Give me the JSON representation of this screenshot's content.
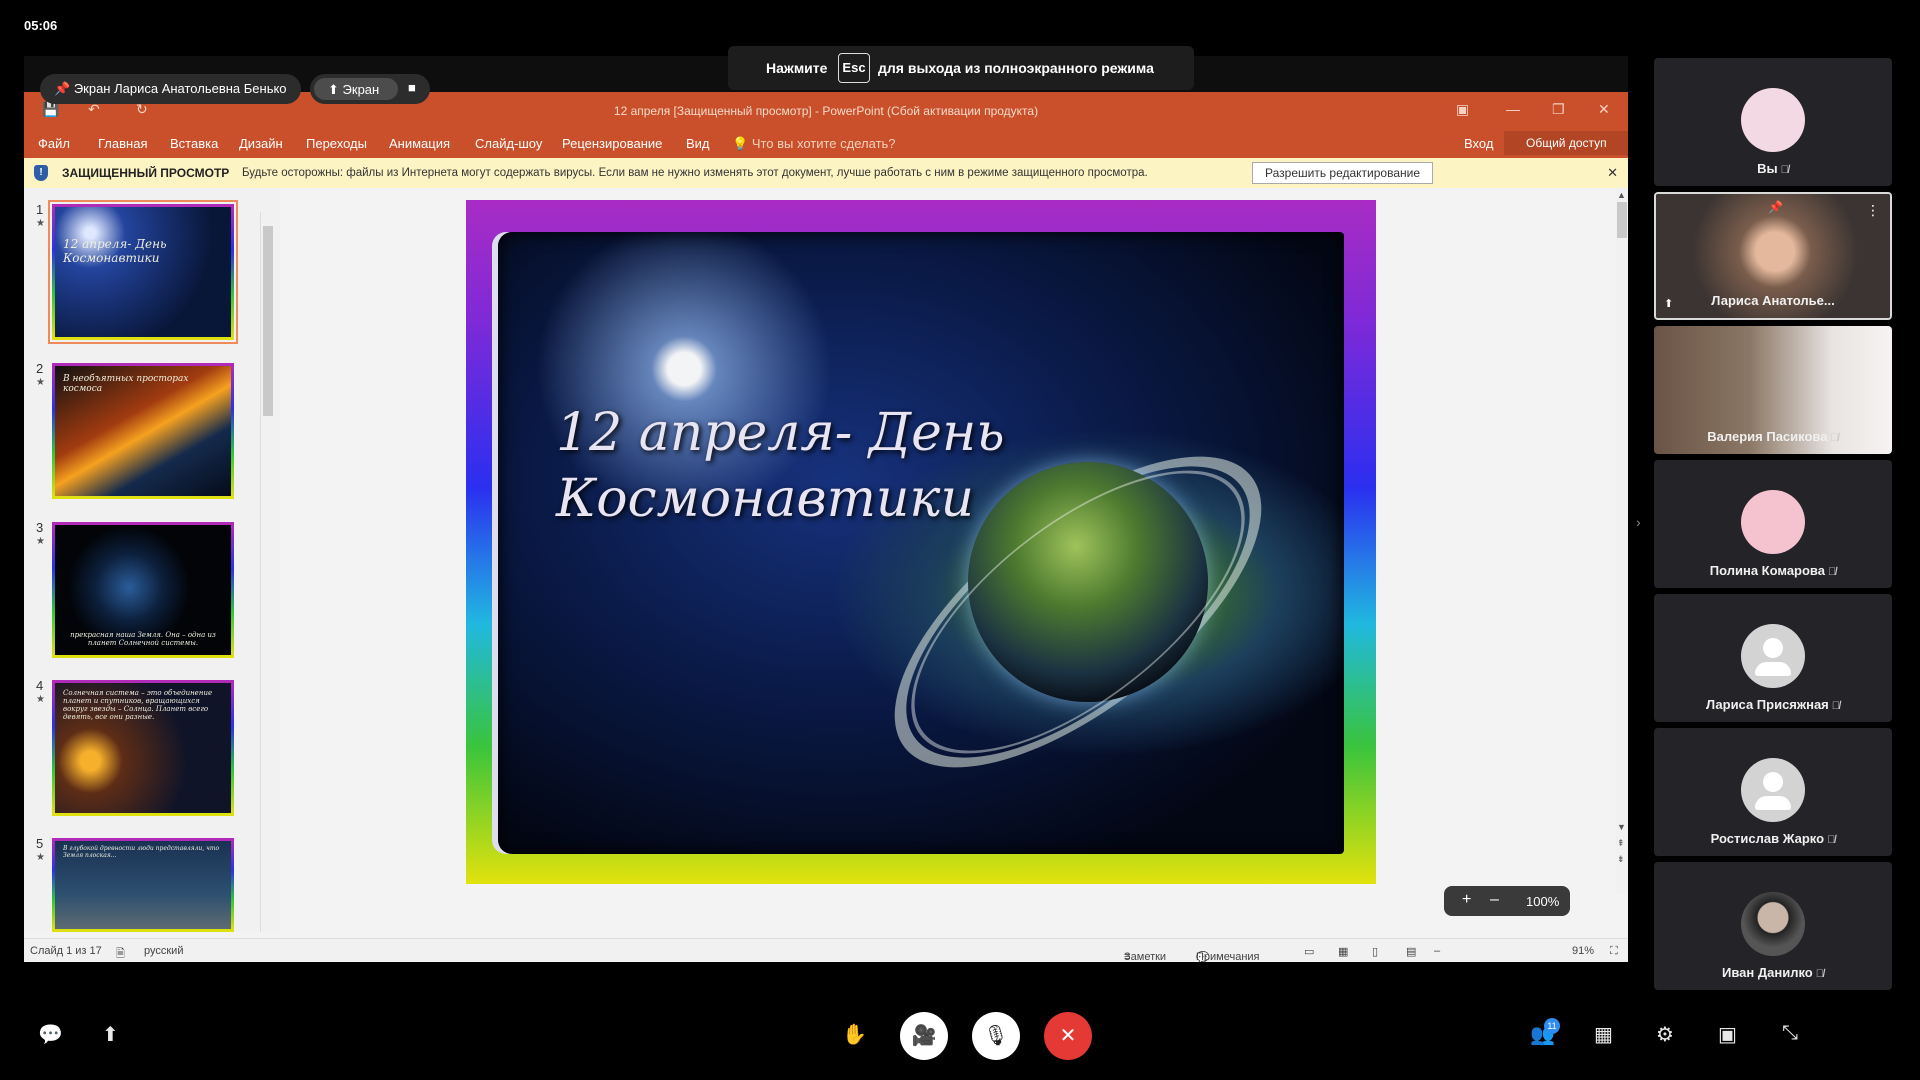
{
  "clock": "05:06",
  "esc_hint": {
    "before": "Нажмите",
    "key": "Esc",
    "after": "для выхода из полноэкранного режима"
  },
  "pin_pill": {
    "label": "Экран Лариса Анатольевна Бенько"
  },
  "screen_pill": {
    "label": "Экран"
  },
  "powerpoint": {
    "window_title": "12 апреля [Защищенный просмотр] - PowerPoint (Сбой активации продукта)",
    "tabs": [
      "Файл",
      "Главная",
      "Вставка",
      "Дизайн",
      "Переходы",
      "Анимация",
      "Слайд-шоу",
      "Рецензирование",
      "Вид"
    ],
    "tell_me": "Что вы хотите сделать?",
    "signin": "Вход",
    "share": "Общий доступ",
    "protected_view": {
      "title": "ЗАЩИЩЕННЫЙ ПРОСМОТР",
      "message": "Будьте осторожны: файлы из Интернета могут содержать вирусы. Если вам не нужно изменять этот документ, лучше работать с ним в режиме защищенного просмотра.",
      "button": "Разрешить редактирование"
    },
    "thumbnails": [
      {
        "num": "1",
        "text": "12 апреля- День Космонавтики"
      },
      {
        "num": "2",
        "text": "В необъятных просторах космоса"
      },
      {
        "num": "3",
        "text": "прекрасная наша Земля. Она – одна из планет Солнечной системы."
      },
      {
        "num": "4",
        "text": "Солнечная система – это объединение планет и спутников, вращающихся вокруг звезды – Солнца. Планет всего девять, все они разные."
      },
      {
        "num": "5",
        "text": "В глубокой древности люди представляли, что Земля плоская..."
      }
    ],
    "slide": {
      "title_line1": "12 апреля- День",
      "title_line2": "Космонавтики"
    },
    "status": {
      "slide_of": "Слайд 1 из 17",
      "language": "русский",
      "notes": "Заметки",
      "comments": "Примечания",
      "zoom_small": "91%"
    },
    "zoom_popup": {
      "value": "100%"
    }
  },
  "participants": [
    {
      "name": "Вы",
      "type": "avatar-photo",
      "color": "#f3d9e3"
    },
    {
      "name": "Лариса Анатолье...",
      "type": "video",
      "active": true
    },
    {
      "name": "Валерия Пасикова",
      "type": "video"
    },
    {
      "name": "Полина Комарова",
      "type": "avatar-photo",
      "color": "#f4c3cf"
    },
    {
      "name": "Лариса Присяжная",
      "type": "avatar-default"
    },
    {
      "name": "Ростислав Жарко",
      "type": "avatar-default"
    },
    {
      "name": "Иван Данилко",
      "type": "avatar-photo",
      "color": "#9aa0a8"
    }
  ],
  "participant_count": "11",
  "colors": {
    "accent_red": "#e53935",
    "ppt_orange": "#c9502a",
    "warn_yellow": "#fdf4c4"
  }
}
